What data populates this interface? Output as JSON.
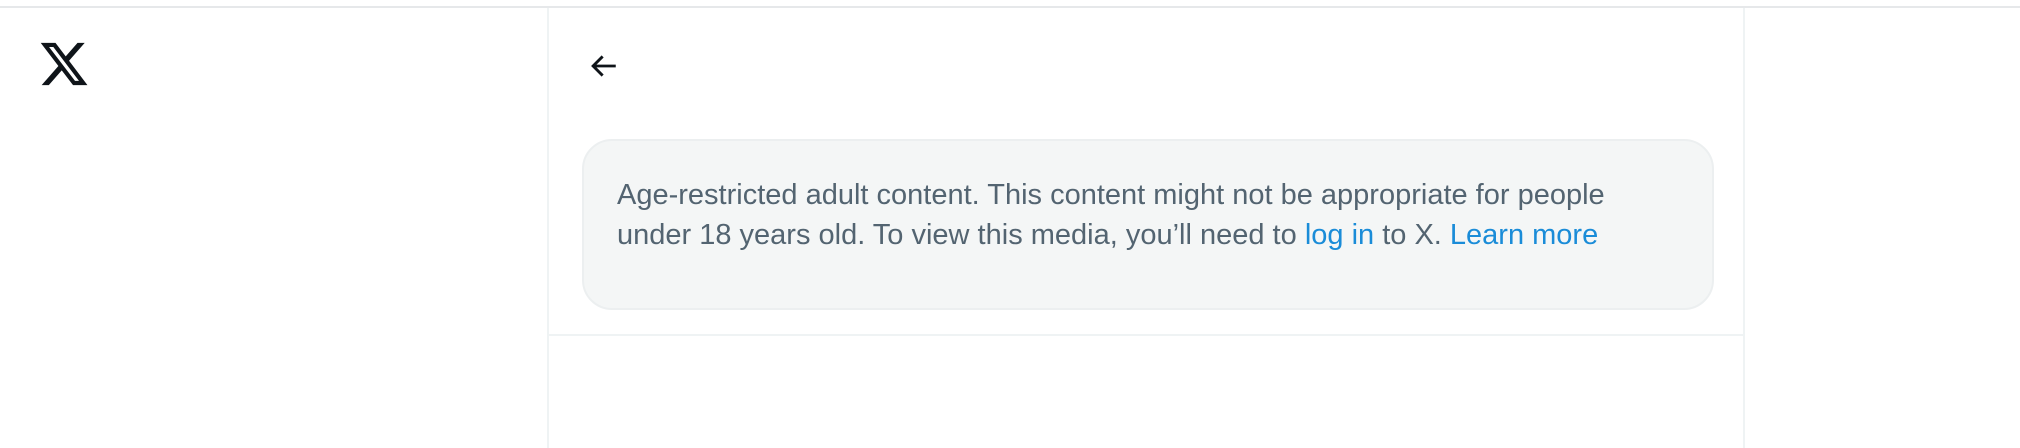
{
  "logo": {
    "icon": "x-logo-icon",
    "color": "#0f1419"
  },
  "header": {
    "back_icon": "arrow-left-icon",
    "back_label": "Back"
  },
  "notice": {
    "text_1": "Age-restricted adult content. This content might not be appropriate for people under 18 years old. To view this media, you’ll need to",
    "login_link": "log in",
    "text_2": "to X.",
    "learn_more_link": "Learn more"
  },
  "colors": {
    "text": "#536471",
    "link": "#1a8cd8",
    "notice_bg": "#f4f6f6",
    "border": "#eff3f4"
  }
}
